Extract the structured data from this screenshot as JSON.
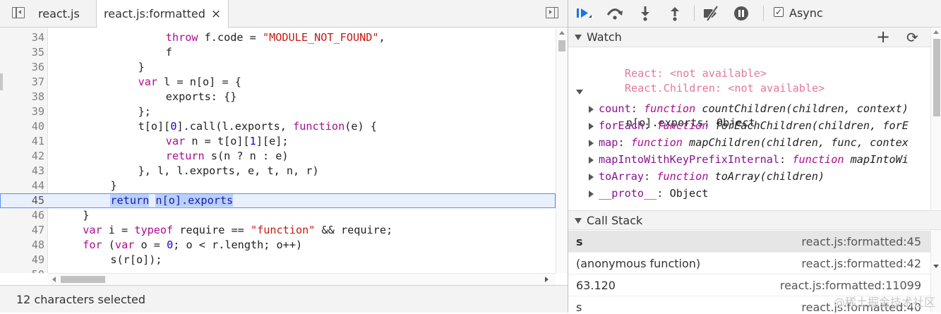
{
  "editor": {
    "tabs": [
      {
        "label": "react.js",
        "active": false
      },
      {
        "label": "react.js:formatted",
        "active": true,
        "close": "×"
      }
    ],
    "status": "12 characters selected",
    "current_line": 45,
    "lines": [
      {
        "n": "34",
        "indent": 5,
        "tokens": [
          {
            "t": "throw",
            "c": "kw"
          },
          {
            "t": " f.code = "
          },
          {
            "t": "\"MODULE_NOT_FOUND\"",
            "c": "str"
          },
          {
            "t": ","
          }
        ]
      },
      {
        "n": "35",
        "indent": 5,
        "tokens": [
          {
            "t": "f"
          }
        ]
      },
      {
        "n": "36",
        "indent": 4,
        "tokens": [
          {
            "t": "}"
          }
        ]
      },
      {
        "n": "37",
        "indent": 4,
        "tokens": [
          {
            "t": "var",
            "c": "kw"
          },
          {
            "t": " l = n[o] = {"
          }
        ]
      },
      {
        "n": "38",
        "indent": 5,
        "tokens": [
          {
            "t": "exports: {}"
          }
        ]
      },
      {
        "n": "39",
        "indent": 4,
        "tokens": [
          {
            "t": "};"
          }
        ]
      },
      {
        "n": "40",
        "indent": 4,
        "tokens": [
          {
            "t": "t[o]["
          },
          {
            "t": "0",
            "c": "num"
          },
          {
            "t": "].call(l.exports, "
          },
          {
            "t": "function",
            "c": "kw"
          },
          {
            "t": "(e) {"
          }
        ]
      },
      {
        "n": "41",
        "indent": 5,
        "tokens": [
          {
            "t": "var",
            "c": "kw"
          },
          {
            "t": " n = t[o]["
          },
          {
            "t": "1",
            "c": "num"
          },
          {
            "t": "][e];"
          }
        ]
      },
      {
        "n": "42",
        "indent": 5,
        "tokens": [
          {
            "t": "return",
            "c": "kw"
          },
          {
            "t": " s(n ? n : e)"
          }
        ]
      },
      {
        "n": "43",
        "indent": 4,
        "tokens": [
          {
            "t": "}, l, l.exports, e, t, n, r)"
          }
        ]
      },
      {
        "n": "44",
        "indent": 3,
        "tokens": [
          {
            "t": "}"
          }
        ]
      },
      {
        "n": "45",
        "indent": 3,
        "tokens": [
          {
            "t": "return",
            "c": "kw sel"
          },
          {
            "t": " ",
            "c": ""
          },
          {
            "t": "n[o].exports",
            "c": "sel"
          }
        ]
      },
      {
        "n": "46",
        "indent": 2,
        "tokens": [
          {
            "t": "}"
          }
        ]
      },
      {
        "n": "47",
        "indent": 2,
        "tokens": [
          {
            "t": "var",
            "c": "kw"
          },
          {
            "t": " i = "
          },
          {
            "t": "typeof",
            "c": "kw"
          },
          {
            "t": " require == "
          },
          {
            "t": "\"function\"",
            "c": "str"
          },
          {
            "t": " && require;"
          }
        ]
      },
      {
        "n": "48",
        "indent": 2,
        "tokens": [
          {
            "t": "for",
            "c": "kw"
          },
          {
            "t": " ("
          },
          {
            "t": "var",
            "c": "kw"
          },
          {
            "t": " o = "
          },
          {
            "t": "0",
            "c": "num"
          },
          {
            "t": "; o < r.length; o++)"
          }
        ]
      },
      {
        "n": "49",
        "indent": 3,
        "tokens": [
          {
            "t": "s(r[o]);"
          }
        ]
      },
      {
        "n": "50",
        "indent": 2,
        "tokens": [
          {
            "t": ""
          }
        ]
      }
    ]
  },
  "debugger": {
    "toolbar": {
      "resume": "resume-icon",
      "step_over": "step-over-icon",
      "step_into": "step-into-icon",
      "step_out": "step-out-icon",
      "deactivate": "deactivate-breakpoints-icon",
      "pause_exceptions": "pause-on-exceptions-icon",
      "async_label": "Async",
      "async_checked": true,
      "check_mark": "✓"
    },
    "watch": {
      "title": "Watch",
      "add": "+",
      "refresh": "⟳",
      "na_entries": [
        {
          "expr": "React:",
          "value": "<not available>"
        },
        {
          "expr": "React.Children:",
          "value": "<not available>"
        }
      ],
      "object_expr": "n[o].exports",
      "object_sep": ": ",
      "object_type": "Object",
      "props": [
        {
          "key": "count",
          "kind": "function",
          "sig": "countChildren(children, context)"
        },
        {
          "key": "forEach",
          "kind": "function",
          "sig": "forEachChildren(children, forE"
        },
        {
          "key": "map",
          "kind": "function",
          "sig": "mapChildren(children, func, contex"
        },
        {
          "key": "mapIntoWithKeyPrefixInternal",
          "kind": "function",
          "sig": "mapIntoWi"
        },
        {
          "key": "toArray",
          "kind": "function",
          "sig": "toArray(children)"
        },
        {
          "key": "__proto__",
          "kind": "",
          "sig": "Object"
        }
      ]
    },
    "call_stack": {
      "title": "Call Stack",
      "frames": [
        {
          "fn": "s",
          "loc": "react.js:formatted:45",
          "selected": true
        },
        {
          "fn": "(anonymous function)",
          "loc": "react.js:formatted:42",
          "selected": false
        },
        {
          "fn": "63.120",
          "loc": "react.js:formatted:11099",
          "selected": false
        },
        {
          "fn": "s",
          "loc": "react.js:formatted:40",
          "selected": false
        }
      ]
    },
    "watermark": "@稀土掘金技术社区"
  }
}
